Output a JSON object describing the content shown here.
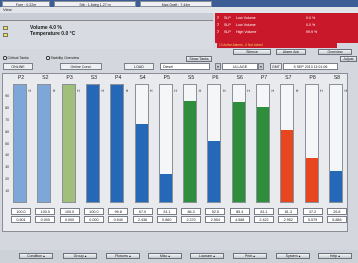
{
  "title": "CARGOMASTER",
  "menu": [
    "View"
  ],
  "info": {
    "fore": "Fore : 0.22m",
    "stb": "Stb : 1.6deg  1.27 m",
    "max_draft": "Max Draft : 7.44m"
  },
  "legend": {
    "volume": "Volume 4.0 %",
    "temperature": "Temperature 0.0 °C"
  },
  "alarms": [
    {
      "tank": "7",
      "code": "SLP",
      "message": "Low Volume",
      "value": "0.0 %"
    },
    {
      "tank": "7",
      "code": "SLP",
      "message": "Low Volume",
      "value": "0.0 %"
    },
    {
      "tank": "7",
      "code": "SLP",
      "message": "High Volume",
      "value": "99.9 %"
    }
  ],
  "alarm_ack": "13 Active Alarms - 0 Not Acked",
  "buttons": {
    "silence": "Silence",
    "alarm_ack": "Alarm Ack",
    "overview": "Overview",
    "show_tanks": "Show Tanks",
    "adjust": "Adjust"
  },
  "options": {
    "critical_tanks": "Critical Tanks",
    "stability_overview": "Stability Overview"
  },
  "status": {
    "online": "ONLINE",
    "online_cond": "Online Cond.",
    "load": "LOAD",
    "fluid": "Diesel",
    "ullage": "ULLAGE",
    "gmt_label": "GMT",
    "datetime": "5 SEP 2013  11:01:06"
  },
  "axis_ticks": [
    "90",
    "80",
    "70",
    "60",
    "50",
    "40",
    "30",
    "20",
    "10"
  ],
  "h_mark": "H",
  "tanks": [
    {
      "name": "P2",
      "level": 100.0,
      "value": "100.0",
      "secondary": "0.601",
      "color": "#7ea6d8"
    },
    {
      "name": "S2",
      "level": 100.0,
      "value": "100.0",
      "secondary": "0.000",
      "color": "#7ea6d8"
    },
    {
      "name": "P3",
      "level": 100.0,
      "value": "100.0",
      "secondary": "0.000",
      "color": "#9fbf7a"
    },
    {
      "name": "S3",
      "level": 100.0,
      "value": "100.0",
      "secondary": "0.000",
      "color": "#2568b8"
    },
    {
      "name": "P4",
      "level": 99.8,
      "value": "99.8",
      "secondary": "0.540",
      "color": "#2568b8"
    },
    {
      "name": "S4",
      "level": 67.0,
      "value": "67.0",
      "secondary": "2.436",
      "color": "#2568b8"
    },
    {
      "name": "P5",
      "level": 24.1,
      "value": "24.1",
      "secondary": "0.860",
      "color": "#2568b8"
    },
    {
      "name": "S5",
      "level": 86.3,
      "value": "86.3",
      "secondary": "2.370",
      "color": "#2f8e3c"
    },
    {
      "name": "P6",
      "level": 52.5,
      "value": "52.5",
      "secondary": "2.554",
      "color": "#2568b8"
    },
    {
      "name": "S6",
      "level": 85.4,
      "value": "85.4",
      "secondary": "4.588",
      "color": "#2f8e3c"
    },
    {
      "name": "P7",
      "level": 81.1,
      "value": "81.1",
      "secondary": "2.422",
      "color": "#2f8e3c"
    },
    {
      "name": "S7",
      "level": 61.3,
      "value": "61.3",
      "secondary": "2.952",
      "color": "#e8461e"
    },
    {
      "name": "P8",
      "level": 37.2,
      "value": "37.2",
      "secondary": "5.579",
      "color": "#e8461e"
    },
    {
      "name": "S8",
      "level": 26.8,
      "value": "26.8",
      "secondary": "5.886",
      "color": "#2568b8"
    }
  ],
  "bottom_buttons": [
    "Condition",
    "Group",
    "Pictures",
    "Misc",
    "Lowcam",
    "Print",
    "System",
    "Help"
  ]
}
